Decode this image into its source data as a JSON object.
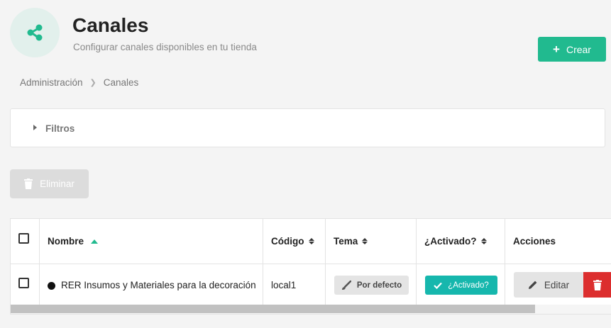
{
  "header": {
    "icon": "share-icon",
    "title": "Canales",
    "subtitle": "Configurar canales disponibles en tu tienda",
    "create_button": "Crear"
  },
  "breadcrumb": [
    "Administración",
    "Canales"
  ],
  "filters": {
    "label": "Filtros"
  },
  "bulk_actions": {
    "delete_label": "Eliminar"
  },
  "table": {
    "columns": [
      "Nombre",
      "Código",
      "Tema",
      "¿Activado?",
      "Acciones"
    ],
    "rows": [
      {
        "name": "RER Insumos y Materiales para la decoración",
        "code": "local1",
        "theme": "Por defecto",
        "active": "¿Activado?",
        "edit": "Editar"
      }
    ]
  },
  "colors": {
    "accent": "#21ba8f",
    "active_badge": "#16b7ad",
    "danger": "#dc2e2e"
  }
}
